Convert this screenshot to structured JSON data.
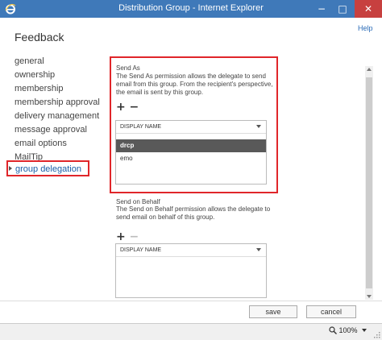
{
  "window": {
    "title": "Distribution Group - Internet Explorer",
    "minimize": "−",
    "maximize": "□",
    "close": "✕"
  },
  "help_link": "Help",
  "page_title": "Feedback",
  "nav": {
    "items": [
      {
        "label": "general"
      },
      {
        "label": "ownership"
      },
      {
        "label": "membership"
      },
      {
        "label": "membership approval"
      },
      {
        "label": "delivery management"
      },
      {
        "label": "message approval"
      },
      {
        "label": "email options"
      },
      {
        "label": "MailTip"
      }
    ],
    "active": {
      "label": "group delegation"
    }
  },
  "send_as": {
    "title": "Send As",
    "description": "The Send As permission allows the delegate to send email from this group. From the recipient's perspective, the email is sent by this group.",
    "add": "+",
    "remove": "−",
    "list": {
      "header": "DISPLAY NAME",
      "rows": [
        "drcp",
        "emo"
      ]
    }
  },
  "send_on_behalf": {
    "title": "Send on Behalf",
    "description": "The Send on Behalf permission allows the delegate to send email on behalf of this group.",
    "add": "+",
    "remove": "−",
    "list": {
      "header": "DISPLAY NAME"
    }
  },
  "footer": {
    "save": "save",
    "cancel": "cancel"
  },
  "status": {
    "zoom": "100%"
  },
  "colors": {
    "titlebar": "#3f79b9",
    "close": "#c7403f",
    "highlight_border": "#e0262a",
    "selected_row": "#595959"
  }
}
